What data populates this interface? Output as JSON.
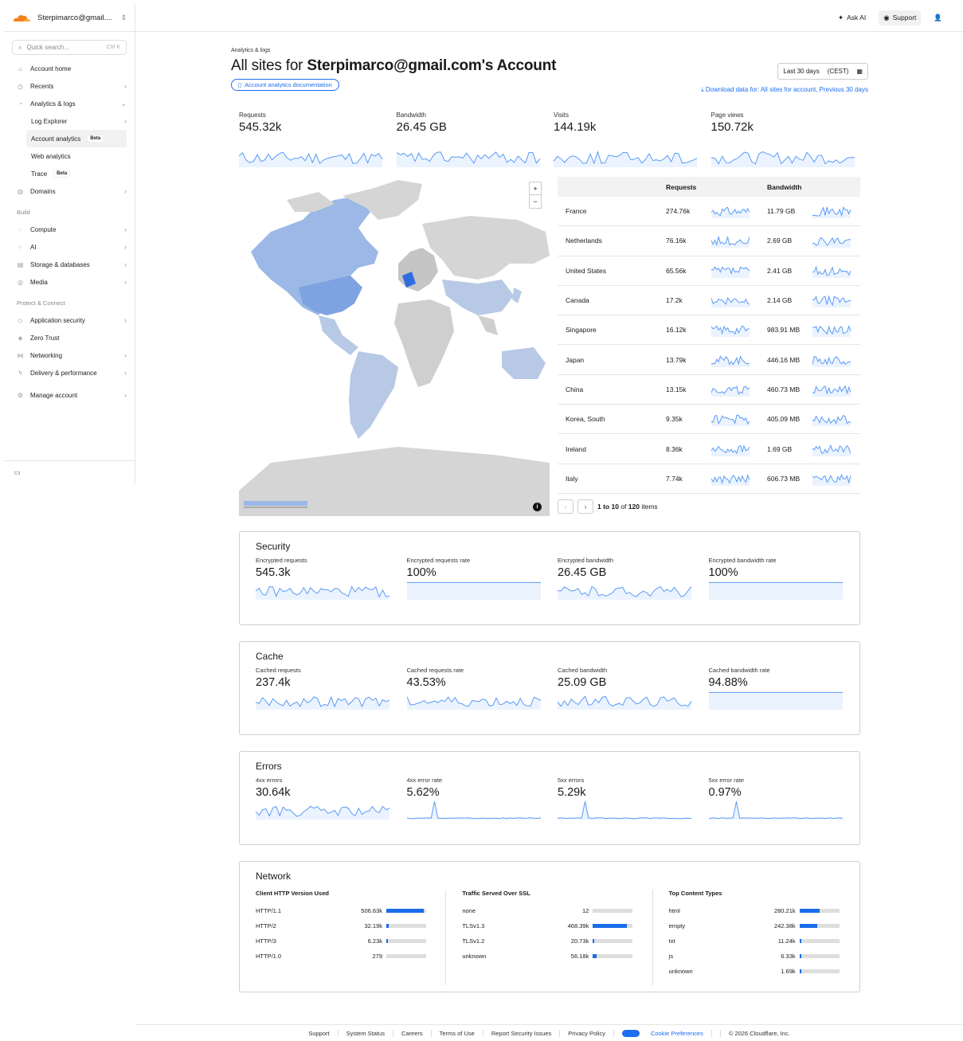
{
  "sidebar": {
    "account": "Sterpimarco@gmail....",
    "search_placeholder": "Quick search...",
    "search_kbd": "Ctrl K",
    "items": [
      {
        "label": "Account home",
        "icon": "home-icon",
        "arrow": ""
      },
      {
        "label": "Recents",
        "icon": "clock-icon",
        "arrow": "›"
      },
      {
        "label": "Analytics & logs",
        "icon": "chart-icon",
        "arrow": "⌄"
      }
    ],
    "sub_items": [
      {
        "label": "Log Explorer",
        "arrow": "›",
        "beta": ""
      },
      {
        "label": "Account analytics",
        "arrow": "",
        "beta": "Beta"
      },
      {
        "label": "Web analytics",
        "arrow": "",
        "beta": ""
      },
      {
        "label": "Trace",
        "arrow": "",
        "beta": "Beta"
      }
    ],
    "domains": "Domains",
    "build_section": "Build",
    "build_items": [
      {
        "label": "Compute",
        "arrow": "›"
      },
      {
        "label": "AI",
        "arrow": "›"
      },
      {
        "label": "Storage & databases",
        "arrow": "›"
      },
      {
        "label": "Media",
        "arrow": "›"
      }
    ],
    "protect_section": "Protect & Connect",
    "protect_items": [
      {
        "label": "Application security",
        "arrow": "›"
      },
      {
        "label": "Zero Trust",
        "arrow": ""
      },
      {
        "label": "Networking",
        "arrow": "›"
      },
      {
        "label": "Delivery & performance",
        "arrow": "›"
      }
    ],
    "manage": "Manage account"
  },
  "topbar": {
    "ask_ai": "Ask AI",
    "support": "Support"
  },
  "header": {
    "breadcrumb": "Analytics & logs",
    "title_prefix": "All sites for ",
    "title_bold": "Sterpimarco@gmail.com's Account",
    "doc_link": "Account analytics documentation",
    "date_range": "Last 30 days",
    "timezone": "(CEST)",
    "download": "Download data for: All sites for account, Previous 30 days"
  },
  "top_stats": [
    {
      "label": "Requests",
      "value": "545.32k"
    },
    {
      "label": "Bandwidth",
      "value": "26.45 GB"
    },
    {
      "label": "Visits",
      "value": "144.19k"
    },
    {
      "label": "Page views",
      "value": "150.72k"
    }
  ],
  "map": {
    "zoom_in": "+",
    "zoom_out": "−",
    "info": "i"
  },
  "country_table": {
    "headers": {
      "requests": "Requests",
      "bandwidth": "Bandwidth"
    },
    "rows": [
      {
        "country": "France",
        "requests": "274.76k",
        "bandwidth": "11.79 GB"
      },
      {
        "country": "Netherlands",
        "requests": "76.16k",
        "bandwidth": "2.69 GB"
      },
      {
        "country": "United States",
        "requests": "65.56k",
        "bandwidth": "2.41 GB"
      },
      {
        "country": "Canada",
        "requests": "17.2k",
        "bandwidth": "2.14 GB"
      },
      {
        "country": "Singapore",
        "requests": "16.12k",
        "bandwidth": "983.91 MB"
      },
      {
        "country": "Japan",
        "requests": "13.79k",
        "bandwidth": "446.16 MB"
      },
      {
        "country": "China",
        "requests": "13.15k",
        "bandwidth": "460.73 MB"
      },
      {
        "country": "Korea, South",
        "requests": "9.35k",
        "bandwidth": "405.09 MB"
      },
      {
        "country": "Ireland",
        "requests": "8.36k",
        "bandwidth": "1.69 GB"
      },
      {
        "country": "Italy",
        "requests": "7.74k",
        "bandwidth": "606.73 MB"
      }
    ],
    "pager_range": "1 to 10",
    "pager_of": "of",
    "pager_total": "120",
    "pager_items": "items"
  },
  "security": {
    "title": "Security",
    "metrics": [
      {
        "label": "Encrypted requests",
        "value": "545.3k"
      },
      {
        "label": "Encrypted requests rate",
        "value": "100%"
      },
      {
        "label": "Encrypted bandwidth",
        "value": "26.45 GB"
      },
      {
        "label": "Encrypted bandwidth rate",
        "value": "100%"
      }
    ]
  },
  "cache": {
    "title": "Cache",
    "metrics": [
      {
        "label": "Cached requests",
        "value": "237.4k"
      },
      {
        "label": "Cached requests rate",
        "value": "43.53%"
      },
      {
        "label": "Cached bandwidth",
        "value": "25.09 GB"
      },
      {
        "label": "Cached bandwidth rate",
        "value": "94.88%"
      }
    ]
  },
  "errors": {
    "title": "Errors",
    "metrics": [
      {
        "label": "4xx errors",
        "value": "30.64k"
      },
      {
        "label": "4xx error rate",
        "value": "5.62%"
      },
      {
        "label": "5xx errors",
        "value": "5.29k"
      },
      {
        "label": "5xx error rate",
        "value": "0.97%"
      }
    ]
  },
  "network": {
    "title": "Network",
    "columns": [
      {
        "title": "Client HTTP Version Used",
        "rows": [
          {
            "label": "HTTP/1.1",
            "value": "506.63k",
            "fraction": 0.93
          },
          {
            "label": "HTTP/2",
            "value": "32.19k",
            "fraction": 0.06
          },
          {
            "label": "HTTP/3",
            "value": "6.23k",
            "fraction": 0.012
          },
          {
            "label": "HTTP/1.0",
            "value": "279",
            "fraction": 0.0
          }
        ]
      },
      {
        "title": "Traffic Served Over SSL",
        "rows": [
          {
            "label": "none",
            "value": "12",
            "fraction": 0.0
          },
          {
            "label": "TLSv1.3",
            "value": "468.39k",
            "fraction": 0.86
          },
          {
            "label": "TLSv1.2",
            "value": "20.73k",
            "fraction": 0.04
          },
          {
            "label": "unknown",
            "value": "56.18k",
            "fraction": 0.1
          }
        ]
      },
      {
        "title": "Top Content Types",
        "rows": [
          {
            "label": "html",
            "value": "280.21k",
            "fraction": 0.51
          },
          {
            "label": "empty",
            "value": "242.38k",
            "fraction": 0.44
          },
          {
            "label": "txt",
            "value": "11.24k",
            "fraction": 0.02
          },
          {
            "label": "js",
            "value": "6.33k",
            "fraction": 0.012
          },
          {
            "label": "unknown",
            "value": "1.69k",
            "fraction": 0.003
          }
        ]
      }
    ]
  },
  "footer": {
    "links": [
      "Support",
      "System Status",
      "Careers",
      "Terms of Use",
      "Report Security Issues",
      "Privacy Policy"
    ],
    "cookie": "Cookie Preferences",
    "copyright": "© 2026 Cloudflare, Inc."
  },
  "colors": {
    "accent": "#1d6ef0",
    "spark": "#5b9bf5",
    "map_fill": "#d5d5d5",
    "map_highlight": "#9bb8e6"
  }
}
